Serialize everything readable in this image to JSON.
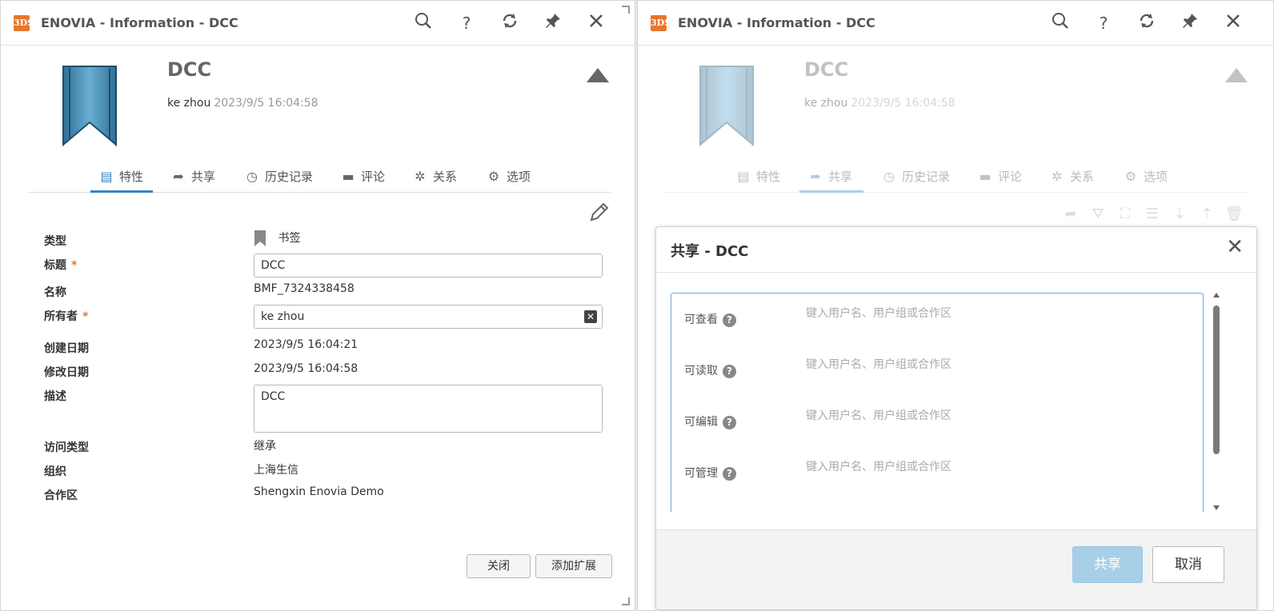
{
  "left": {
    "window_title": "ENOVIA - Information - DCC",
    "logo_text": "3DS",
    "header": {
      "title": "DCC",
      "owner": "ke zhou",
      "timestamp": "2023/9/5 16:04:58"
    },
    "tabs": [
      {
        "label": "特性",
        "icon": "properties-icon",
        "active": true
      },
      {
        "label": "共享",
        "icon": "share-icon"
      },
      {
        "label": "历史记录",
        "icon": "history-icon"
      },
      {
        "label": "评论",
        "icon": "comment-icon"
      },
      {
        "label": "关系",
        "icon": "relations-icon"
      },
      {
        "label": "选项",
        "icon": "gear-icon"
      }
    ],
    "fields": {
      "type_label": "类型",
      "type_value": "书签",
      "title_label": "标题",
      "title_value": "DCC",
      "name_label": "名称",
      "name_value": "BMF_7324338458",
      "owner_label": "所有者",
      "owner_value": "ke zhou",
      "created_label": "创建日期",
      "created_value": "2023/9/5 16:04:21",
      "modified_label": "修改日期",
      "modified_value": "2023/9/5 16:04:58",
      "desc_label": "描述",
      "desc_value": "DCC",
      "access_label": "访问类型",
      "access_value": "继承",
      "org_label": "组织",
      "org_value": "上海生信",
      "collab_label": "合作区",
      "collab_value": "Shengxin Enovia Demo"
    },
    "required_mark": "*",
    "buttons": {
      "close": "关闭",
      "add_extension": "添加扩展"
    }
  },
  "right": {
    "window_title": "ENOVIA - Information - DCC",
    "logo_text": "3DS",
    "header": {
      "title": "DCC",
      "owner": "ke zhou",
      "timestamp": "2023/9/5 16:04:58"
    },
    "tabs": [
      {
        "label": "特性",
        "icon": "properties-icon"
      },
      {
        "label": "共享",
        "icon": "share-icon",
        "active": true
      },
      {
        "label": "历史记录",
        "icon": "history-icon"
      },
      {
        "label": "评论",
        "icon": "comment-icon"
      },
      {
        "label": "关系",
        "icon": "relations-icon"
      },
      {
        "label": "选项",
        "icon": "gear-icon"
      }
    ],
    "dialog": {
      "title": "共享 - DCC",
      "rows": [
        {
          "label": "可查看",
          "placeholder": "键入用户名、用户组或合作区"
        },
        {
          "label": "可读取",
          "placeholder": "键入用户名、用户组或合作区"
        },
        {
          "label": "可编辑",
          "placeholder": "键入用户名、用户组或合作区"
        },
        {
          "label": "可管理",
          "placeholder": "键入用户名、用户组或合作区"
        }
      ],
      "help_glyph": "?",
      "share_button": "共享",
      "cancel_button": "取消"
    }
  },
  "accent_color": "#3a82c4"
}
